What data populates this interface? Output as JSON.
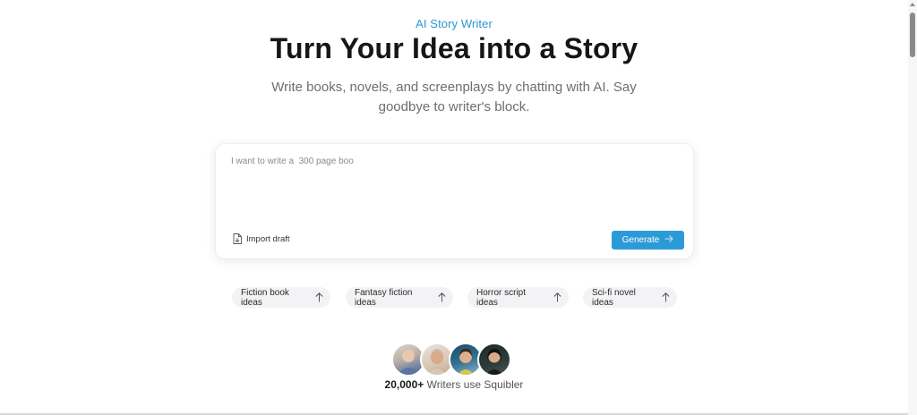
{
  "hero": {
    "eyebrow": "AI Story Writer",
    "title": "Turn Your Idea into a Story",
    "subtitle": "Write books, novels, and screenplays by chatting with AI. Say goodbye to writer's block."
  },
  "prompt": {
    "value": "I want to write a  300 page boo",
    "import_label": "Import draft",
    "generate_label": "Generate"
  },
  "suggestions": [
    {
      "label": "Fiction book ideas"
    },
    {
      "label": "Fantasy fiction ideas"
    },
    {
      "label": "Horror script ideas"
    },
    {
      "label": "Sci-fi novel ideas"
    }
  ],
  "social_proof": {
    "count": "20,000+",
    "text": "Writers use Squibler"
  },
  "colors": {
    "accent": "#2d9ad8",
    "chip_bg": "#f3f3f5"
  }
}
